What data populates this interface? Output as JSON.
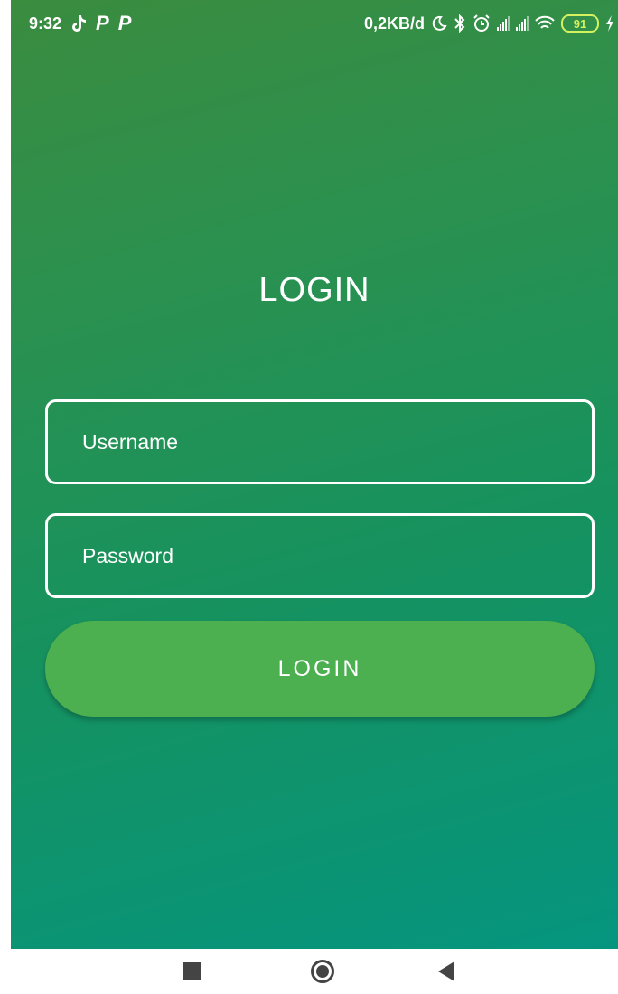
{
  "status_bar": {
    "time": "9:32",
    "app_icons": [
      "tiktok-icon",
      "p-app-icon",
      "p-app-icon"
    ],
    "p_letter": "P",
    "network_speed": "0,2KB/d",
    "battery": "91",
    "icons": [
      "moon-icon",
      "bluetooth-icon",
      "alarm-icon",
      "signal-icon",
      "signal-icon",
      "wifi-icon",
      "battery-icon",
      "charging-icon"
    ]
  },
  "login": {
    "title": "LOGIN",
    "username_placeholder": "Username",
    "password_placeholder": "Password",
    "button_label": "LOGIN"
  },
  "colors": {
    "gradient_top": "#3a8c3f",
    "gradient_bottom": "#05957f",
    "button": "#4caf50",
    "battery": "#d4f260"
  },
  "nav_bar": {
    "icons": [
      "recent-apps-icon",
      "home-icon",
      "back-icon"
    ]
  }
}
